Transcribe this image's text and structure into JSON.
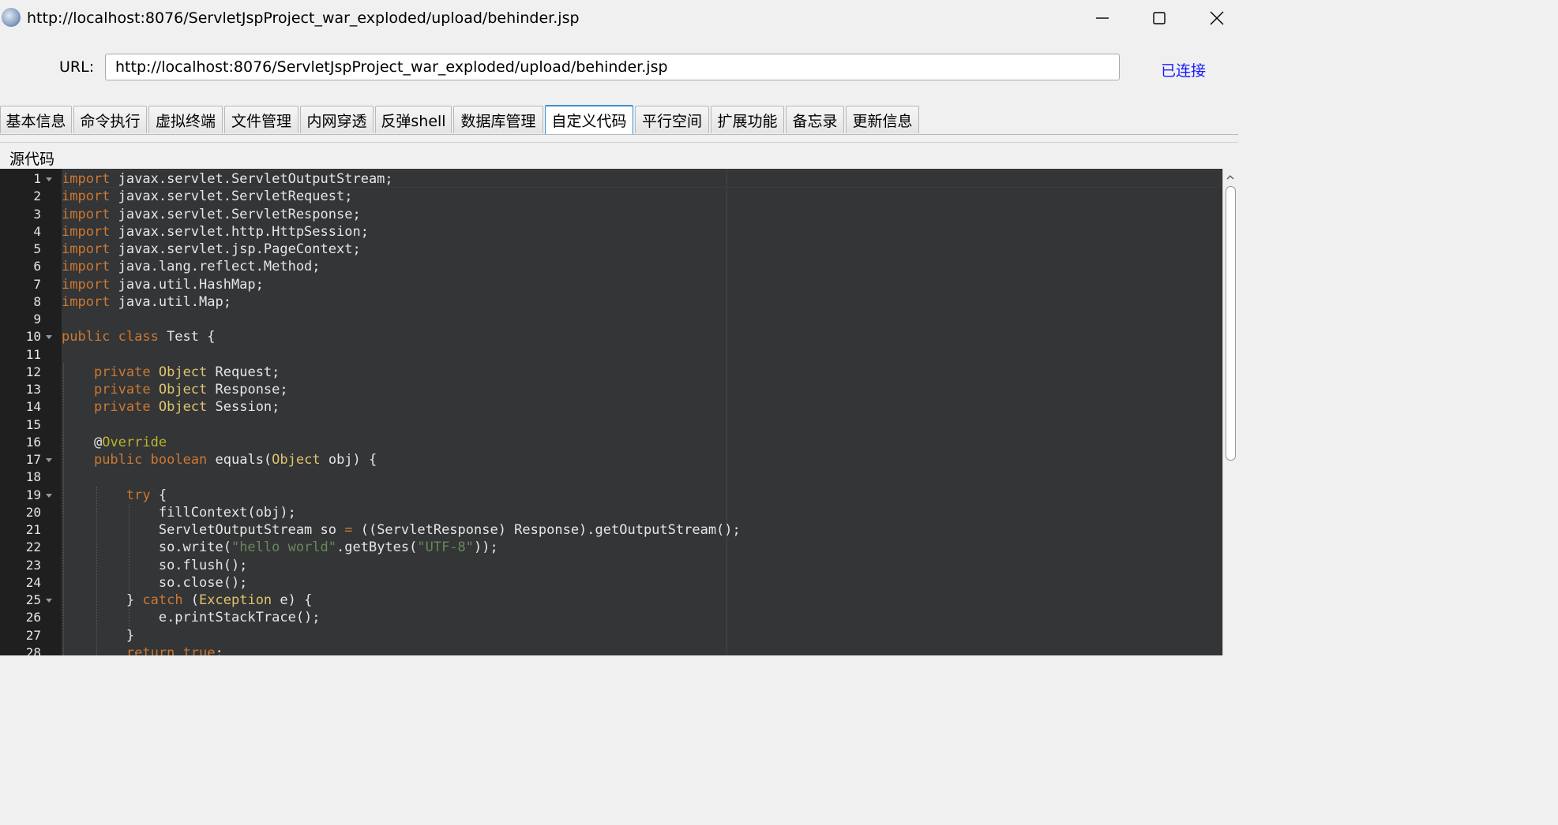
{
  "window": {
    "title": "http://localhost:8076/ServletJspProject_war_exploded/upload/behinder.jsp",
    "controls": [
      "minimize",
      "maximize",
      "close"
    ]
  },
  "url_bar": {
    "label": "URL:",
    "value": "http://localhost:8076/ServletJspProject_war_exploded/upload/behinder.jsp",
    "status": "已连接",
    "status_color": "#1a1aff"
  },
  "tabs": [
    {
      "label": "基本信息"
    },
    {
      "label": "命令执行"
    },
    {
      "label": "虚拟终端"
    },
    {
      "label": "文件管理"
    },
    {
      "label": "内网穿透"
    },
    {
      "label": "反弹shell"
    },
    {
      "label": "数据库管理"
    },
    {
      "label": "自定义代码",
      "active": true
    },
    {
      "label": "平行空间"
    },
    {
      "label": "扩展功能"
    },
    {
      "label": "备忘录"
    },
    {
      "label": "更新信息"
    }
  ],
  "section_label": "源代码",
  "editor": {
    "lines": [
      {
        "n": "1",
        "fold": true,
        "tokens": [
          [
            "kw",
            "import"
          ],
          [
            "id",
            " javax.servlet.ServletOutputStream;"
          ]
        ]
      },
      {
        "n": "2",
        "tokens": [
          [
            "kw",
            "import"
          ],
          [
            "id",
            " javax.servlet.ServletRequest;"
          ]
        ]
      },
      {
        "n": "3",
        "tokens": [
          [
            "kw",
            "import"
          ],
          [
            "id",
            " javax.servlet.ServletResponse;"
          ]
        ]
      },
      {
        "n": "4",
        "tokens": [
          [
            "kw",
            "import"
          ],
          [
            "id",
            " javax.servlet.http.HttpSession;"
          ]
        ]
      },
      {
        "n": "5",
        "tokens": [
          [
            "kw",
            "import"
          ],
          [
            "id",
            " javax.servlet.jsp.PageContext;"
          ]
        ]
      },
      {
        "n": "6",
        "tokens": [
          [
            "kw",
            "import"
          ],
          [
            "id",
            " java.lang.reflect.Method;"
          ]
        ]
      },
      {
        "n": "7",
        "tokens": [
          [
            "kw",
            "import"
          ],
          [
            "id",
            " java.util.HashMap;"
          ]
        ]
      },
      {
        "n": "8",
        "tokens": [
          [
            "kw",
            "import"
          ],
          [
            "id",
            " java.util.Map;"
          ]
        ]
      },
      {
        "n": "9",
        "tokens": []
      },
      {
        "n": "10",
        "fold": true,
        "tokens": [
          [
            "kw",
            "public class"
          ],
          [
            "id",
            " Test {"
          ]
        ]
      },
      {
        "n": "11",
        "tokens": []
      },
      {
        "n": "12",
        "tokens": [
          [
            "pl",
            "    "
          ],
          [
            "kw",
            "private"
          ],
          [
            "pl",
            " "
          ],
          [
            "ty",
            "Object"
          ],
          [
            "id",
            " Request;"
          ]
        ]
      },
      {
        "n": "13",
        "tokens": [
          [
            "pl",
            "    "
          ],
          [
            "kw",
            "private"
          ],
          [
            "pl",
            " "
          ],
          [
            "ty",
            "Object"
          ],
          [
            "id",
            " Response;"
          ]
        ]
      },
      {
        "n": "14",
        "tokens": [
          [
            "pl",
            "    "
          ],
          [
            "kw",
            "private"
          ],
          [
            "pl",
            " "
          ],
          [
            "ty",
            "Object"
          ],
          [
            "id",
            " Session;"
          ]
        ]
      },
      {
        "n": "15",
        "tokens": []
      },
      {
        "n": "16",
        "tokens": [
          [
            "pl",
            "    "
          ],
          [
            "id",
            "@"
          ],
          [
            "an",
            "Override"
          ]
        ]
      },
      {
        "n": "17",
        "fold": true,
        "tokens": [
          [
            "pl",
            "    "
          ],
          [
            "kw",
            "public"
          ],
          [
            "pl",
            " "
          ],
          [
            "kw",
            "boolean"
          ],
          [
            "id",
            " equals("
          ],
          [
            "ty",
            "Object"
          ],
          [
            "id",
            " obj) {"
          ]
        ]
      },
      {
        "n": "18",
        "tokens": []
      },
      {
        "n": "19",
        "fold": true,
        "tokens": [
          [
            "pl",
            "        "
          ],
          [
            "kw",
            "try"
          ],
          [
            "id",
            " {"
          ]
        ]
      },
      {
        "n": "20",
        "tokens": [
          [
            "pl",
            "            "
          ],
          [
            "id",
            "fillContext(obj);"
          ]
        ]
      },
      {
        "n": "21",
        "tokens": [
          [
            "pl",
            "            "
          ],
          [
            "id",
            "ServletOutputStream so "
          ],
          [
            "kw",
            "="
          ],
          [
            "id",
            " ((ServletResponse) Response).getOutputStream();"
          ]
        ]
      },
      {
        "n": "22",
        "tokens": [
          [
            "pl",
            "            "
          ],
          [
            "id",
            "so.write("
          ],
          [
            "st",
            "\"hello world\""
          ],
          [
            "id",
            ".getBytes("
          ],
          [
            "st",
            "\"UTF-8\""
          ],
          [
            "id",
            "));"
          ]
        ]
      },
      {
        "n": "23",
        "tokens": [
          [
            "pl",
            "            "
          ],
          [
            "id",
            "so.flush();"
          ]
        ]
      },
      {
        "n": "24",
        "tokens": [
          [
            "pl",
            "            "
          ],
          [
            "id",
            "so.close();"
          ]
        ]
      },
      {
        "n": "25",
        "fold": true,
        "tokens": [
          [
            "pl",
            "        "
          ],
          [
            "id",
            "} "
          ],
          [
            "kw",
            "catch"
          ],
          [
            "id",
            " ("
          ],
          [
            "ty",
            "Exception"
          ],
          [
            "id",
            " e) {"
          ]
        ]
      },
      {
        "n": "26",
        "tokens": [
          [
            "pl",
            "            "
          ],
          [
            "id",
            "e.printStackTrace();"
          ]
        ]
      },
      {
        "n": "27",
        "tokens": [
          [
            "pl",
            "        "
          ],
          [
            "id",
            "}"
          ]
        ]
      },
      {
        "n": "28",
        "tokens": [
          [
            "pl",
            "        "
          ],
          [
            "kw",
            "return"
          ],
          [
            "pl",
            " "
          ],
          [
            "kw",
            "true"
          ],
          [
            "id",
            ";"
          ]
        ]
      }
    ]
  }
}
